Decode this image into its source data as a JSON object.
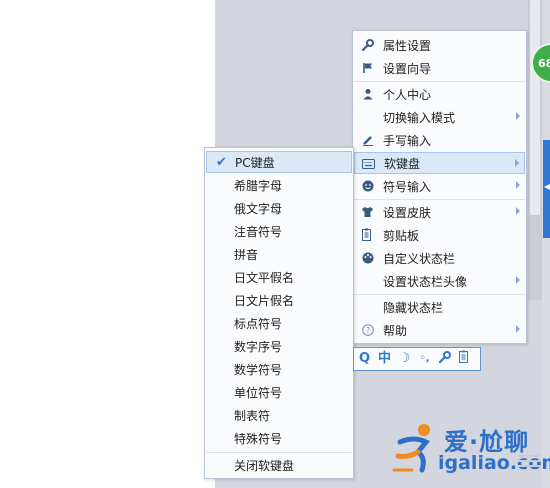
{
  "badge": {
    "text": "68"
  },
  "main_menu": {
    "items": [
      {
        "label": "属性设置",
        "icon": "wrench-icon",
        "submenu": false
      },
      {
        "label": "设置向导",
        "icon": "flag-icon",
        "submenu": false
      },
      {
        "label": "个人中心",
        "icon": "user-icon",
        "submenu": false
      },
      {
        "label": "切换输入模式",
        "icon": "",
        "submenu": true
      },
      {
        "label": "手写输入",
        "icon": "pen-icon",
        "submenu": false
      },
      {
        "label": "软键盘",
        "icon": "keyboard-icon",
        "submenu": true,
        "highlighted": true
      },
      {
        "label": "符号输入",
        "icon": "smiley-icon",
        "submenu": true
      },
      {
        "label": "设置皮肤",
        "icon": "shirt-icon",
        "submenu": true
      },
      {
        "label": "剪贴板",
        "icon": "clipboard-icon",
        "submenu": false
      },
      {
        "label": "自定义状态栏",
        "icon": "palette-icon",
        "submenu": false
      },
      {
        "label": "设置状态栏头像",
        "icon": "",
        "submenu": true
      },
      {
        "label": "隐藏状态栏",
        "icon": "",
        "submenu": false
      },
      {
        "label": "帮助",
        "icon": "help-icon",
        "submenu": true
      }
    ]
  },
  "soft_keyboard_menu": {
    "items": [
      {
        "label": "PC键盘",
        "checked": true
      },
      {
        "label": "希腊字母"
      },
      {
        "label": "俄文字母"
      },
      {
        "label": "注音符号"
      },
      {
        "label": "拼音"
      },
      {
        "label": "日文平假名"
      },
      {
        "label": "日文片假名"
      },
      {
        "label": "标点符号"
      },
      {
        "label": "数字序号"
      },
      {
        "label": "数学符号"
      },
      {
        "label": "单位符号"
      },
      {
        "label": "制表符"
      },
      {
        "label": "特殊符号"
      },
      {
        "label": "关闭软键盘"
      }
    ]
  },
  "toolbar": {
    "search_icon": "Q",
    "lang_text": "中",
    "moon_icon": "☽",
    "punct_text": "◦,",
    "wrench_icon": "wrench-icon",
    "clipboard_icon": "clipboard-icon"
  },
  "watermark": {
    "cn": "爱·尬聊",
    "url": "igaliao.com"
  },
  "colors": {
    "accent": "#2e78cf",
    "highlight": "#dbe8f8",
    "badge": "#3fae49",
    "side_tab": "#2e79d6"
  }
}
